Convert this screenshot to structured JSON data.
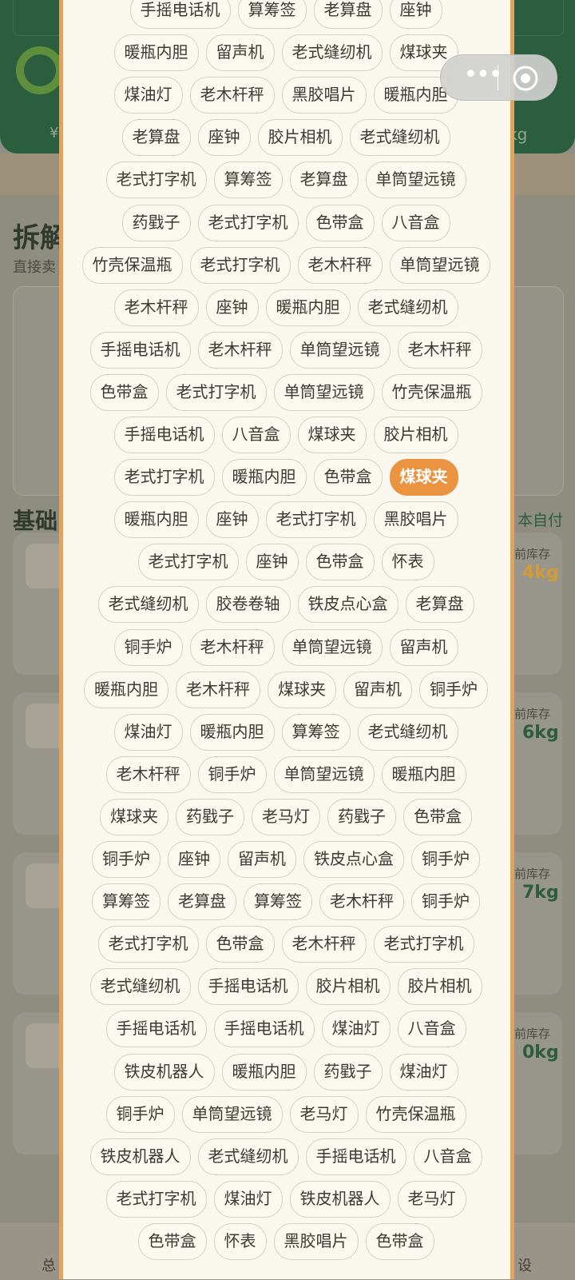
{
  "background": {
    "header_money": "¥",
    "header_kg": "kg",
    "title": "拆解",
    "subtitle": "直接卖",
    "section_title": "基础",
    "self_pay": "本自付",
    "cards": [
      {
        "stock_label": "前库存",
        "stock_value": "4kg"
      },
      {
        "stock_label": "前库存",
        "stock_value": "6kg"
      },
      {
        "stock_label": "前库存",
        "stock_value": "7kg"
      },
      {
        "stock_label": "前库存",
        "stock_value": "0kg"
      }
    ],
    "nav_left": "总",
    "nav_right": "设"
  },
  "capsule": {
    "more": "•••"
  },
  "colors": {
    "accent": "#ea9341",
    "sheet_border": "#e6a25a",
    "header_green": "#2b5e3e"
  },
  "chips": [
    [
      "手摇电话机",
      "算筹签",
      "老算盘",
      "座钟"
    ],
    [
      "暖瓶内胆",
      "留声机",
      "老式缝纫机",
      "煤球夹"
    ],
    [
      "煤油灯",
      "老木杆秤",
      "黑胶唱片",
      "暖瓶内胆"
    ],
    [
      "老算盘",
      "座钟",
      "胶片相机",
      "老式缝纫机"
    ],
    [
      "老式打字机",
      "算筹签",
      "老算盘",
      "单筒望远镜"
    ],
    [
      "药戥子",
      "老式打字机",
      "色带盒",
      "八音盒"
    ],
    [
      "竹壳保温瓶",
      "老式打字机",
      "老木杆秤",
      "单筒望远镜"
    ],
    [
      "老木杆秤",
      "座钟",
      "暖瓶内胆",
      "老式缝纫机"
    ],
    [
      "手摇电话机",
      "老木杆秤",
      "单筒望远镜",
      "老木杆秤"
    ],
    [
      "色带盒",
      "老式打字机",
      "单筒望远镜",
      "竹壳保温瓶"
    ],
    [
      "手摇电话机",
      "八音盒",
      "煤球夹",
      "胶片相机"
    ],
    [
      "老式打字机",
      "暖瓶内胆",
      "色带盒",
      "煤球夹"
    ],
    [
      "暖瓶内胆",
      "座钟",
      "老式打字机",
      "黑胶唱片"
    ],
    [
      "老式打字机",
      "座钟",
      "色带盒",
      "怀表"
    ],
    [
      "老式缝纫机",
      "胶卷卷轴",
      "铁皮点心盒",
      "老算盘"
    ],
    [
      "铜手炉",
      "老木杆秤",
      "单筒望远镜",
      "留声机"
    ],
    [
      "暖瓶内胆",
      "老木杆秤",
      "煤球夹",
      "留声机",
      "铜手炉"
    ],
    [
      "煤油灯",
      "暖瓶内胆",
      "算筹签",
      "老式缝纫机"
    ],
    [
      "老木杆秤",
      "铜手炉",
      "单筒望远镜",
      "暖瓶内胆"
    ],
    [
      "煤球夹",
      "药戥子",
      "老马灯",
      "药戥子",
      "色带盒"
    ],
    [
      "铜手炉",
      "座钟",
      "留声机",
      "铁皮点心盒",
      "铜手炉"
    ],
    [
      "算筹签",
      "老算盘",
      "算筹签",
      "老木杆秤",
      "铜手炉"
    ],
    [
      "老式打字机",
      "色带盒",
      "老木杆秤",
      "老式打字机"
    ],
    [
      "老式缝纫机",
      "手摇电话机",
      "胶片相机",
      "胶片相机"
    ],
    [
      "手摇电话机",
      "手摇电话机",
      "煤油灯",
      "八音盒"
    ],
    [
      "铁皮机器人",
      "暖瓶内胆",
      "药戥子",
      "煤油灯"
    ],
    [
      "铜手炉",
      "单筒望远镜",
      "老马灯",
      "竹壳保温瓶"
    ],
    [
      "铁皮机器人",
      "老式缝纫机",
      "手摇电话机",
      "八音盒"
    ],
    [
      "老式打字机",
      "煤油灯",
      "铁皮机器人",
      "老马灯"
    ],
    [
      "色带盒",
      "怀表",
      "黑胶唱片",
      "色带盒"
    ]
  ],
  "selected": {
    "row": 11,
    "col": 3
  }
}
